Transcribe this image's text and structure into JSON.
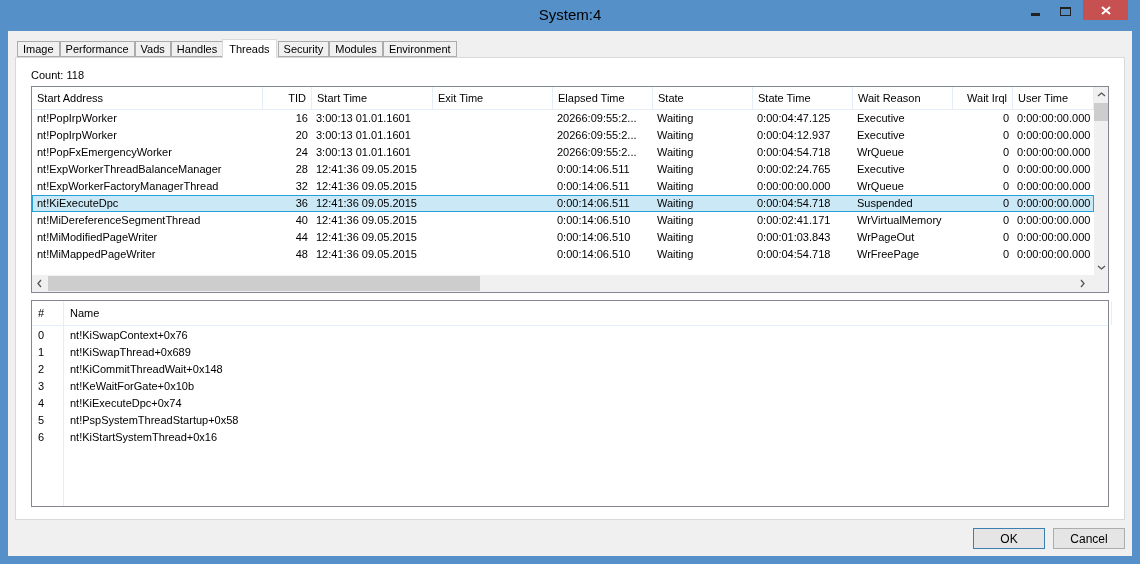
{
  "window": {
    "title": "System:4"
  },
  "tabs": [
    {
      "label": "Image",
      "selected": false
    },
    {
      "label": "Performance",
      "selected": false
    },
    {
      "label": "Vads",
      "selected": false
    },
    {
      "label": "Handles",
      "selected": false
    },
    {
      "label": "Threads",
      "selected": true
    },
    {
      "label": "Security",
      "selected": false
    },
    {
      "label": "Modules",
      "selected": false
    },
    {
      "label": "Environment",
      "selected": false
    }
  ],
  "count": "Count: 118",
  "threads_table": {
    "columns": [
      "Start Address",
      "TID",
      "Start Time",
      "Exit Time",
      "Elapsed Time",
      "State",
      "State Time",
      "Wait Reason",
      "Wait Irql",
      "User Time"
    ],
    "rows": [
      {
        "selected": false,
        "cells": [
          "nt!PopIrpWorker",
          "16",
          "3:00:13 01.01.1601",
          "",
          "20266:09:55:2...",
          "Waiting",
          "0:00:04:47.125",
          "Executive",
          "0",
          "0:00:00:00.000"
        ]
      },
      {
        "selected": false,
        "cells": [
          "nt!PopIrpWorker",
          "20",
          "3:00:13 01.01.1601",
          "",
          "20266:09:55:2...",
          "Waiting",
          "0:00:04:12.937",
          "Executive",
          "0",
          "0:00:00:00.000"
        ]
      },
      {
        "selected": false,
        "cells": [
          "nt!PopFxEmergencyWorker",
          "24",
          "3:00:13 01.01.1601",
          "",
          "20266:09:55:2...",
          "Waiting",
          "0:00:04:54.718",
          "WrQueue",
          "0",
          "0:00:00:00.000"
        ]
      },
      {
        "selected": false,
        "cells": [
          "nt!ExpWorkerThreadBalanceManager",
          "28",
          "12:41:36 09.05.2015",
          "",
          "0:00:14:06.511",
          "Waiting",
          "0:00:02:24.765",
          "Executive",
          "0",
          "0:00:00:00.000"
        ]
      },
      {
        "selected": false,
        "cells": [
          "nt!ExpWorkerFactoryManagerThread",
          "32",
          "12:41:36 09.05.2015",
          "",
          "0:00:14:06.511",
          "Waiting",
          "0:00:00:00.000",
          "WrQueue",
          "0",
          "0:00:00:00.000"
        ]
      },
      {
        "selected": true,
        "cells": [
          "nt!KiExecuteDpc",
          "36",
          "12:41:36 09.05.2015",
          "",
          "0:00:14:06.511",
          "Waiting",
          "0:00:04:54.718",
          "Suspended",
          "0",
          "0:00:00:00.000"
        ]
      },
      {
        "selected": false,
        "cells": [
          "nt!MiDereferenceSegmentThread",
          "40",
          "12:41:36 09.05.2015",
          "",
          "0:00:14:06.510",
          "Waiting",
          "0:00:02:41.171",
          "WrVirtualMemory",
          "0",
          "0:00:00:00.000"
        ]
      },
      {
        "selected": false,
        "cells": [
          "nt!MiModifiedPageWriter",
          "44",
          "12:41:36 09.05.2015",
          "",
          "0:00:14:06.510",
          "Waiting",
          "0:00:01:03.843",
          "WrPageOut",
          "0",
          "0:00:00:00.000"
        ]
      },
      {
        "selected": false,
        "cells": [
          "nt!MiMappedPageWriter",
          "48",
          "12:41:36 09.05.2015",
          "",
          "0:00:14:06.510",
          "Waiting",
          "0:00:04:54.718",
          "WrFreePage",
          "0",
          "0:00:00:00.000"
        ]
      }
    ]
  },
  "stack_table": {
    "columns": [
      "#",
      "Name"
    ],
    "rows": [
      [
        "0",
        "nt!KiSwapContext+0x76"
      ],
      [
        "1",
        "nt!KiSwapThread+0x689"
      ],
      [
        "2",
        "nt!KiCommitThreadWait+0x148"
      ],
      [
        "3",
        "nt!KeWaitForGate+0x10b"
      ],
      [
        "4",
        "nt!KiExecuteDpc+0x74"
      ],
      [
        "5",
        "nt!PspSystemThreadStartup+0x58"
      ],
      [
        "6",
        "nt!KiStartSystemThread+0x16"
      ]
    ]
  },
  "buttons": [
    {
      "label": "OK",
      "kind": "default"
    },
    {
      "label": "Cancel",
      "kind": "normal"
    }
  ]
}
